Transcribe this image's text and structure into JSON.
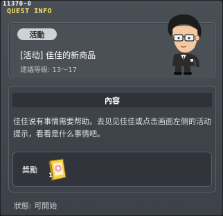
{
  "window": {
    "quest_id": "11370-0",
    "title": "QUEST INFO"
  },
  "quest": {
    "category": "活動",
    "name": "[活动] 佳佳的新商品",
    "level": "建議等級: 13～17"
  },
  "content": {
    "header": "內容",
    "description": "佳佳说有事情需要帮助。去见见佳佳或点击画面左侧的活动提示，看看是什么事情吧。"
  },
  "reward": {
    "label": "獎勵",
    "item_icon": "book-icon",
    "item_count": "1"
  },
  "status": {
    "text": "狀態:  可開始"
  },
  "colors": {
    "title_accent": "#f6e26a",
    "panel_bg": "#4b5057",
    "header_bg": "#2f3339"
  }
}
